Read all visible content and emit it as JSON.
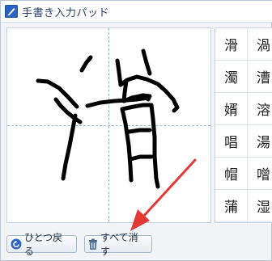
{
  "title": {
    "text": "手書き入力パッド",
    "icon": "pen-pad-icon"
  },
  "candidates": [
    "滑",
    "渦",
    "濁",
    "漕",
    "婿",
    "溶",
    "唱",
    "湯",
    "帽",
    "噌",
    "蒲",
    "湿"
  ],
  "buttons": {
    "undo_label": "ひとつ戻る",
    "undo_icon": "undo-icon",
    "clear_label": "すべて消す",
    "clear_icon": "trash-icon"
  },
  "colors": {
    "accent": "#2b63c2",
    "stroke": "#000000",
    "arrow": "#e53935"
  }
}
